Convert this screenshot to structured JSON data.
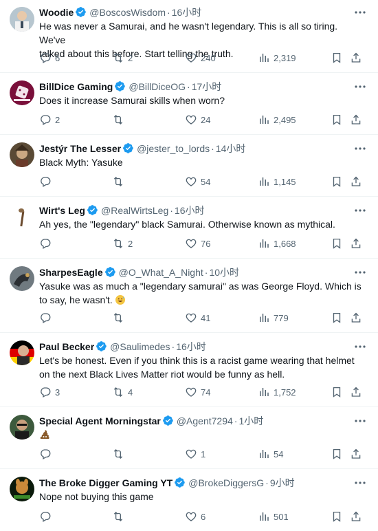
{
  "tweets": [
    {
      "name": "Woodie",
      "handle": "@BoscosWisdom",
      "time": "16小时",
      "lines": [
        "He was never a Samurai, and he wasn't legendary. This is all so tiring. We've",
        "talked about this before. Start telling the truth."
      ],
      "replies": "6",
      "reposts": "2",
      "likes": "240",
      "views": "2,319"
    },
    {
      "name": "BillDice Gaming",
      "handle": "@BillDiceOG",
      "time": "17小时",
      "lines": [
        "Does it increase Samurai skills when worn?"
      ],
      "replies": "2",
      "reposts": "",
      "likes": "24",
      "views": "2,495"
    },
    {
      "name": "Jestýr The Lesser",
      "handle": "@jester_to_lords",
      "time": "14小时",
      "lines": [
        "Black Myth: Yasuke"
      ],
      "replies": "",
      "reposts": "",
      "likes": "54",
      "views": "1,145"
    },
    {
      "name": "Wirt's Leg",
      "handle": "@RealWirtsLeg",
      "time": "16小时",
      "lines": [
        "Ah yes, the \"legendary\" black Samurai. Otherwise known as mythical."
      ],
      "replies": "",
      "reposts": "2",
      "likes": "76",
      "views": "1,668"
    },
    {
      "name": "SharpesEagle",
      "handle": "@O_What_A_Night",
      "time": "10小时",
      "lines": [
        "Yasuke was as much a \"legendary samurai\" as was George Floyd. Which is",
        "to say, he wasn't."
      ],
      "emoji": "grinning-sweat",
      "replies": "",
      "reposts": "",
      "likes": "41",
      "views": "779"
    },
    {
      "name": "Paul Becker",
      "handle": "@Saulimedes",
      "time": "16小时",
      "lines": [
        "Let's be honest. Even if you think this is a racist game wearing that helmet",
        "on the next Black Lives Matter riot would be funny as hell."
      ],
      "replies": "3",
      "reposts": "4",
      "likes": "74",
      "views": "1,752"
    },
    {
      "name": "Special Agent Morningstar",
      "handle": "@Agent7294",
      "time": "1小时",
      "lines": [
        ""
      ],
      "emoji": "pile-of-poo",
      "replies": "",
      "reposts": "",
      "likes": "1",
      "views": "54"
    },
    {
      "name": "The Broke Digger Gaming YT",
      "handle": "@BrokeDiggersG",
      "time": "9小时",
      "lines": [
        "Nope not buying this game"
      ],
      "replies": "",
      "reposts": "",
      "likes": "6",
      "views": "501"
    }
  ],
  "colors": {
    "verified": "#1d9bf0",
    "secondary": "#536471",
    "divider": "#eff3f4"
  }
}
